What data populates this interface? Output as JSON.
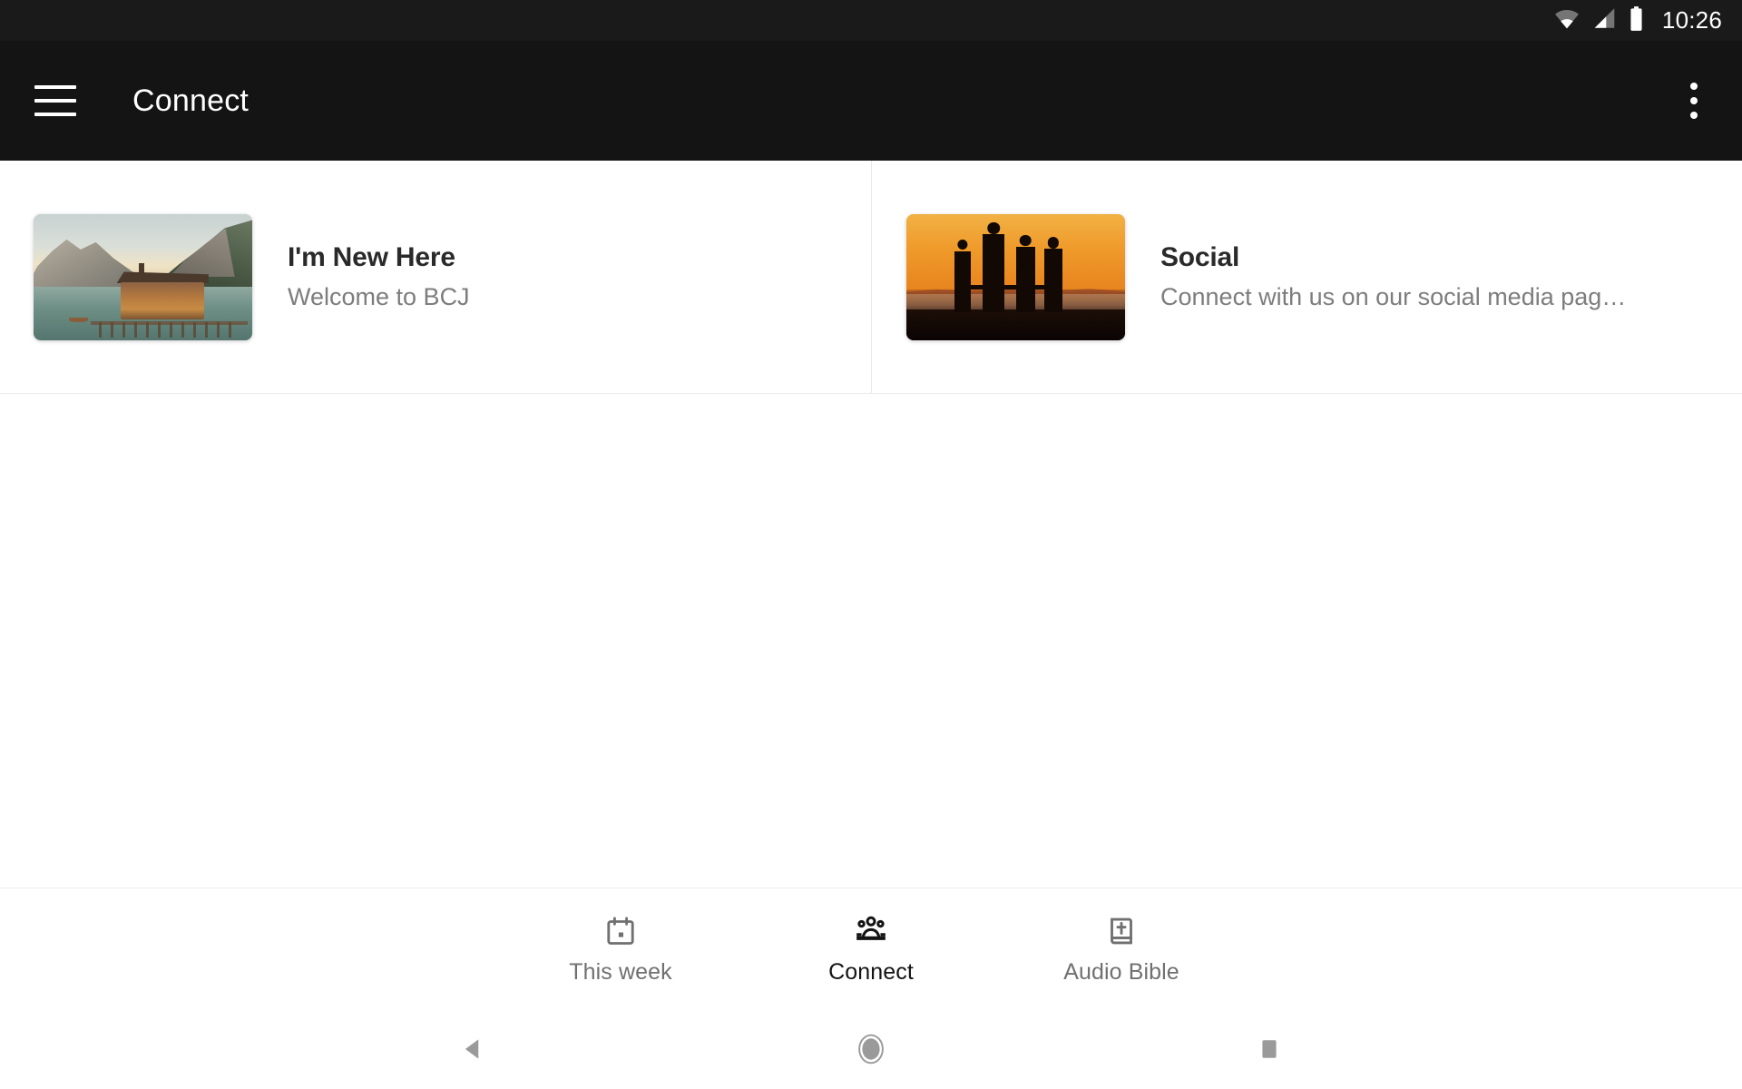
{
  "status_bar": {
    "time": "10:26",
    "icons": [
      "wifi-icon",
      "cellular-signal-icon",
      "battery-icon"
    ]
  },
  "app_bar": {
    "menu_icon": "hamburger-menu-icon",
    "title": "Connect",
    "overflow_icon": "overflow-menu-icon"
  },
  "cards": [
    {
      "title": "I'm New Here",
      "subtitle": "Welcome to BCJ",
      "thumbnail": "lake-mountain-cabin-photo"
    },
    {
      "title": "Social",
      "subtitle": "Connect with us on our social media pag…",
      "thumbnail": "sunset-family-silhouette-photo"
    }
  ],
  "bottom_nav": {
    "items": [
      {
        "label": "This week",
        "icon": "calendar-icon",
        "active": false
      },
      {
        "label": "Connect",
        "icon": "people-group-icon",
        "active": true
      },
      {
        "label": "Audio Bible",
        "icon": "bible-book-icon",
        "active": false
      }
    ]
  },
  "system_nav": {
    "back": "back-triangle-icon",
    "home": "home-circle-icon",
    "recents": "recents-square-icon"
  },
  "colors": {
    "status_bar_bg": "#1a1a1a",
    "app_bar_bg": "#141414",
    "content_bg": "#ffffff",
    "title_text": "#2a2a2a",
    "subtitle_text": "#7d7d7d",
    "nav_inactive": "#707070",
    "nav_active": "#141414",
    "divider": "#eaeaea"
  }
}
